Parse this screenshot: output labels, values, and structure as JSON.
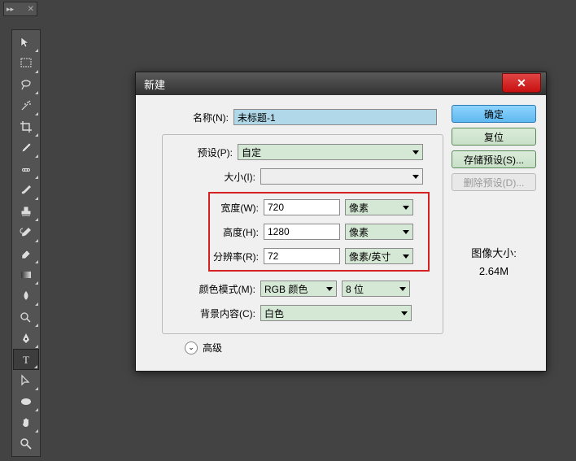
{
  "topPanel": {
    "expand": "▸▸",
    "close": "✕"
  },
  "tools": [
    {
      "name": "move-tool",
      "sub": true
    },
    {
      "name": "marquee-tool",
      "sub": true
    },
    {
      "name": "lasso-tool",
      "sub": true
    },
    {
      "name": "magic-wand-tool",
      "sub": true
    },
    {
      "name": "crop-tool",
      "sub": true
    },
    {
      "name": "eyedropper-tool",
      "sub": true
    },
    {
      "name": "spot-heal-tool",
      "sub": true
    },
    {
      "name": "brush-tool",
      "sub": true
    },
    {
      "name": "stamp-tool",
      "sub": true
    },
    {
      "name": "history-brush-tool",
      "sub": true
    },
    {
      "name": "eraser-tool",
      "sub": true
    },
    {
      "name": "gradient-tool",
      "sub": true
    },
    {
      "name": "blur-tool",
      "sub": true
    },
    {
      "name": "dodge-tool",
      "sub": true
    },
    {
      "name": "pen-tool",
      "sub": true
    },
    {
      "name": "type-tool",
      "sub": true,
      "selected": true
    },
    {
      "name": "path-select-tool",
      "sub": true
    },
    {
      "name": "shape-tool",
      "sub": true
    },
    {
      "name": "hand-tool",
      "sub": true
    },
    {
      "name": "zoom-tool",
      "sub": false
    }
  ],
  "dialog": {
    "title": "新建",
    "name": {
      "label": "名称(N):",
      "value": "未标题-1"
    },
    "preset": {
      "label": "预设(P):",
      "value": "自定"
    },
    "size": {
      "label": "大小(I):",
      "value": ""
    },
    "width": {
      "label": "宽度(W):",
      "value": "720",
      "unit": "像素"
    },
    "height": {
      "label": "高度(H):",
      "value": "1280",
      "unit": "像素"
    },
    "resolution": {
      "label": "分辨率(R):",
      "value": "72",
      "unit": "像素/英寸"
    },
    "colorMode": {
      "label": "颜色模式(M):",
      "value": "RGB 颜色",
      "depth": "8 位"
    },
    "bgContent": {
      "label": "背景内容(C):",
      "value": "白色"
    },
    "advanced": "高级",
    "imageSize": {
      "label": "图像大小:",
      "value": "2.64M"
    },
    "buttons": {
      "ok": "确定",
      "reset": "复位",
      "savePreset": "存储预设(S)...",
      "deletePreset": "删除预设(D)..."
    }
  }
}
